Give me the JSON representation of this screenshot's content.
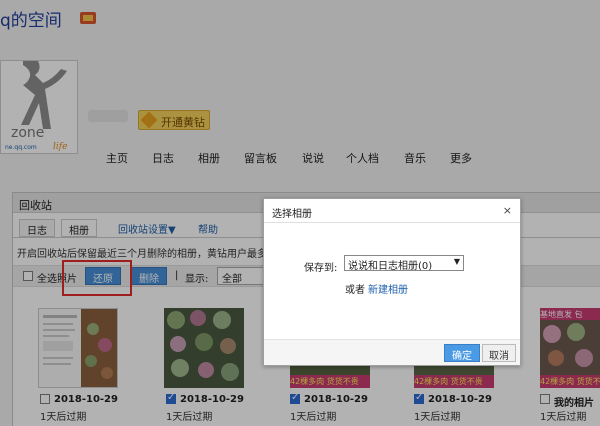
{
  "header": {
    "title": "q的空间"
  },
  "profile": {
    "avatar_logo_text": "zone",
    "avatar_sub_text": "ne.qq.com",
    "vip_label": "开通黄钻"
  },
  "nav": {
    "items": [
      "主页",
      "日志",
      "相册",
      "留言板",
      "说说",
      "个人档",
      "音乐",
      "更多"
    ]
  },
  "recycle": {
    "title": "回收站",
    "tabs": {
      "journal": "日志",
      "album": "相册",
      "settings": "回收站设置▼",
      "help": "帮助"
    },
    "info_text": "开启回收站后保留最近三个月删除的相册，黄钻用户最多保",
    "toolbar": {
      "select_all": "全选照片",
      "restore": "还原",
      "delete": "删除",
      "separator": "|",
      "display_label": "显示:",
      "display_value": "全部"
    }
  },
  "photos": [
    {
      "date": "2018-10-29",
      "expire": "1天后过期",
      "checked": false,
      "caption": "",
      "banner": ""
    },
    {
      "date": "2018-10-29",
      "expire": "1天后过期",
      "checked": true,
      "caption": "",
      "banner": ""
    },
    {
      "date": "2018-10-29",
      "expire": "1天后过期",
      "checked": true,
      "caption": "42棵多肉  货货不贵",
      "banner": ""
    },
    {
      "date": "2018-10-29",
      "expire": "1天后过期",
      "checked": true,
      "caption": "42棵多肉  货货不贵",
      "banner": ""
    },
    {
      "date": "我的相片",
      "expire": "1天后过期",
      "checked": false,
      "caption": "42棵多肉  货货不贵",
      "banner": "基地直发  包"
    }
  ],
  "dialog": {
    "title": "选择相册",
    "close": "×",
    "save_to_label": "保存到:",
    "album_select": "说说和日志相册(0)",
    "or_text": "或者",
    "new_album_link": "新建相册",
    "confirm": "确定",
    "cancel": "取消"
  },
  "colors": {
    "accent": "#4a90d9",
    "highlight": "#e32b2b",
    "link": "#1d5fab",
    "caption_bg": "#c83b70"
  }
}
